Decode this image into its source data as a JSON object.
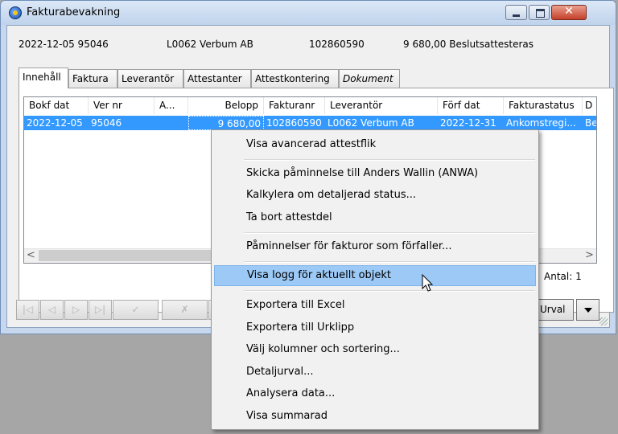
{
  "window": {
    "title": "Fakturabevakning"
  },
  "info": {
    "date_ver": "2022-12-05  95046",
    "supplier": "L0062 Verbum AB",
    "invoice_no": "102860590",
    "amount_status": "9 680,00  Beslutsattesteras"
  },
  "tabs": [
    {
      "label": "Innehåll"
    },
    {
      "label": "Faktura"
    },
    {
      "label": "Leverantör"
    },
    {
      "label": "Attestanter"
    },
    {
      "label": "Attestkontering"
    },
    {
      "label": "Dokument"
    }
  ],
  "table": {
    "columns": [
      "Bokf dat",
      "Ver nr",
      "A...",
      "Belopp",
      "Fakturanr",
      "Leverantör",
      "Förf dat",
      "Fakturastatus",
      "D"
    ],
    "rows": [
      [
        "2022-12-05",
        "95046",
        "",
        "9 680,00",
        "102860590",
        "L0062 Verbum AB",
        "2022-12-31",
        "Ankomstregi...",
        "Be"
      ]
    ]
  },
  "scroll": {
    "left": "<",
    "right": ">"
  },
  "antal": "Antal: 1",
  "nav": {
    "first": "|◁",
    "prev": "◁",
    "next": "▷",
    "last": "▷|",
    "approve": "✓",
    "reject": "✗"
  },
  "urval": "Urval",
  "context_menu": {
    "items": [
      "Visa avancerad attestflik",
      "Skicka påminnelse till Anders Wallin (ANWA)",
      "Kalkylera om detaljerad status...",
      "Ta bort attestdel",
      "Påminnelser för fakturor som förfaller...",
      "Visa logg för aktuellt objekt",
      "Exportera till Excel",
      "Exportera till Urklipp",
      "Välj kolumner och sortering...",
      "Detaljurval...",
      "Analysera data...",
      "Visa summarad"
    ],
    "highlighted": "Visa logg för aktuellt objekt"
  },
  "colors": {
    "selection": "#3399ff",
    "menu_highlight": "#9cc9f6",
    "title_bar": "#c7d8ee"
  }
}
